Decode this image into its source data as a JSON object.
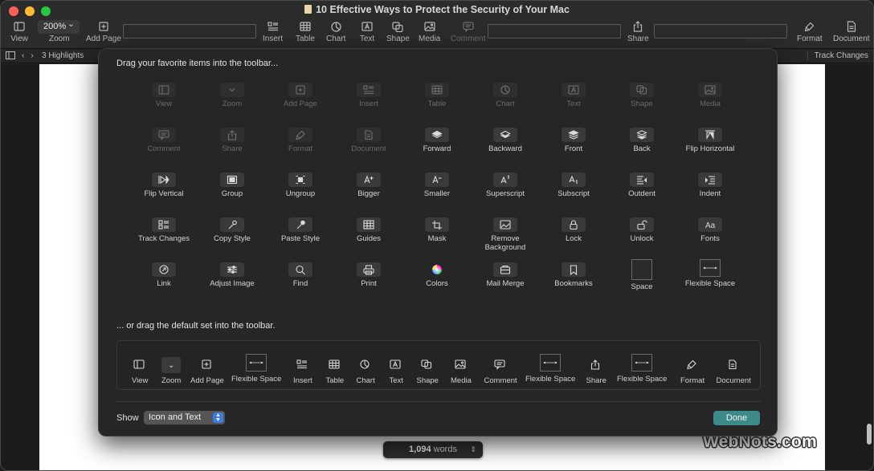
{
  "window": {
    "title": "10 Effective Ways to Protect the Security of Your Mac"
  },
  "toolbar": {
    "view": "View",
    "zoom_value": "200%",
    "zoom": "Zoom",
    "add_page": "Add Page",
    "insert": "Insert",
    "table": "Table",
    "chart": "Chart",
    "text": "Text",
    "shape": "Shape",
    "media": "Media",
    "comment": "Comment",
    "share": "Share",
    "format": "Format",
    "document": "Document"
  },
  "subbar": {
    "highlights": "3 Highlights",
    "track_changes": "Track Changes"
  },
  "sheet": {
    "heading": "Drag your favorite items into the toolbar...",
    "items": [
      {
        "label": "View",
        "icon": "sidebar-icon",
        "dim": true
      },
      {
        "label": "Zoom",
        "icon": "chevron-down-icon",
        "dim": true
      },
      {
        "label": "Add Page",
        "icon": "add-page-icon",
        "dim": true
      },
      {
        "label": "Insert",
        "icon": "insert-icon",
        "dim": true
      },
      {
        "label": "Table",
        "icon": "table-icon",
        "dim": true
      },
      {
        "label": "Chart",
        "icon": "chart-icon",
        "dim": true
      },
      {
        "label": "Text",
        "icon": "text-icon",
        "dim": true
      },
      {
        "label": "Shape",
        "icon": "shape-icon",
        "dim": true
      },
      {
        "label": "Media",
        "icon": "media-icon",
        "dim": true
      },
      {
        "label": "Comment",
        "icon": "comment-icon",
        "dim": true
      },
      {
        "label": "Share",
        "icon": "share-icon",
        "dim": true
      },
      {
        "label": "Format",
        "icon": "format-icon",
        "dim": true
      },
      {
        "label": "Document",
        "icon": "document-icon",
        "dim": true
      },
      {
        "label": "Forward",
        "icon": "forward-icon",
        "dim": false
      },
      {
        "label": "Backward",
        "icon": "backward-icon",
        "dim": false
      },
      {
        "label": "Front",
        "icon": "front-icon",
        "dim": false
      },
      {
        "label": "Back",
        "icon": "back-icon",
        "dim": false
      },
      {
        "label": "Flip Horizontal",
        "icon": "flip-horizontal-icon",
        "dim": false
      },
      {
        "label": "Flip Vertical",
        "icon": "flip-vertical-icon",
        "dim": false
      },
      {
        "label": "Group",
        "icon": "group-icon",
        "dim": false
      },
      {
        "label": "Ungroup",
        "icon": "ungroup-icon",
        "dim": false
      },
      {
        "label": "Bigger",
        "icon": "bigger-icon",
        "dim": false
      },
      {
        "label": "Smaller",
        "icon": "smaller-icon",
        "dim": false
      },
      {
        "label": "Superscript",
        "icon": "superscript-icon",
        "dim": false
      },
      {
        "label": "Subscript",
        "icon": "subscript-icon",
        "dim": false
      },
      {
        "label": "Outdent",
        "icon": "outdent-icon",
        "dim": false
      },
      {
        "label": "Indent",
        "icon": "indent-icon",
        "dim": false
      },
      {
        "label": "Track Changes",
        "icon": "track-changes-icon",
        "dim": false
      },
      {
        "label": "Copy Style",
        "icon": "copy-style-icon",
        "dim": false
      },
      {
        "label": "Paste Style",
        "icon": "paste-style-icon",
        "dim": false
      },
      {
        "label": "Guides",
        "icon": "guides-icon",
        "dim": false
      },
      {
        "label": "Mask",
        "icon": "mask-icon",
        "dim": false
      },
      {
        "label": "Remove Background",
        "icon": "remove-background-icon",
        "dim": false
      },
      {
        "label": "Lock",
        "icon": "lock-icon",
        "dim": false
      },
      {
        "label": "Unlock",
        "icon": "unlock-icon",
        "dim": false
      },
      {
        "label": "Fonts",
        "icon": "fonts-icon",
        "dim": false
      },
      {
        "label": "Link",
        "icon": "link-icon",
        "dim": false
      },
      {
        "label": "Adjust Image",
        "icon": "adjust-image-icon",
        "dim": false
      },
      {
        "label": "Find",
        "icon": "find-icon",
        "dim": false
      },
      {
        "label": "Print",
        "icon": "print-icon",
        "dim": false
      },
      {
        "label": "Colors",
        "icon": "colors-icon",
        "dim": false
      },
      {
        "label": "Mail Merge",
        "icon": "mail-merge-icon",
        "dim": false
      },
      {
        "label": "Bookmarks",
        "icon": "bookmarks-icon",
        "dim": false
      },
      {
        "label": "Space",
        "icon": "space-icon",
        "dim": false
      },
      {
        "label": "Flexible Space",
        "icon": "flexible-space-icon",
        "dim": false
      }
    ],
    "default_heading": "... or drag the default set into the toolbar.",
    "default_set": [
      {
        "label": "View",
        "icon": "sidebar-icon"
      },
      {
        "label": "Zoom",
        "icon": "zoom-popup-icon"
      },
      {
        "label": "Add Page",
        "icon": "add-page-icon"
      },
      {
        "label": "Flexible Space",
        "icon": "flexible-space-icon"
      },
      {
        "label": "Insert",
        "icon": "insert-icon"
      },
      {
        "label": "Table",
        "icon": "table-icon"
      },
      {
        "label": "Chart",
        "icon": "chart-icon"
      },
      {
        "label": "Text",
        "icon": "text-icon"
      },
      {
        "label": "Shape",
        "icon": "shape-icon"
      },
      {
        "label": "Media",
        "icon": "media-icon"
      },
      {
        "label": "Comment",
        "icon": "comment-icon"
      },
      {
        "label": "Flexible Space",
        "icon": "flexible-space-icon"
      },
      {
        "label": "Share",
        "icon": "share-icon"
      },
      {
        "label": "Flexible Space",
        "icon": "flexible-space-icon"
      },
      {
        "label": "Format",
        "icon": "format-icon"
      },
      {
        "label": "Document",
        "icon": "document-icon"
      }
    ],
    "show_label": "Show",
    "show_value": "Icon and Text",
    "done_label": "Done"
  },
  "status": {
    "word_count": "1,094",
    "word_unit": "words"
  },
  "watermark": "WebNots.com",
  "colors": {
    "accent_done": "#3d8a8a",
    "select_stepper": "#3b7de4"
  }
}
